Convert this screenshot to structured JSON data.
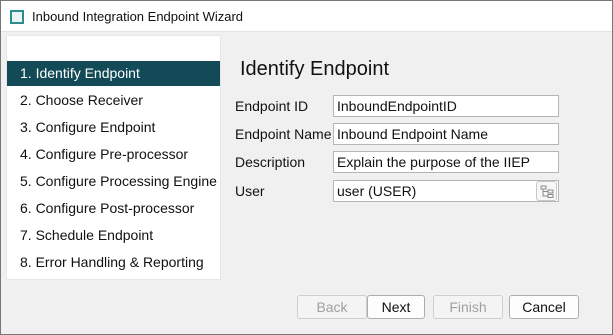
{
  "window": {
    "title": "Inbound Integration Endpoint Wizard"
  },
  "steps": [
    {
      "label": "1. Identify Endpoint",
      "active": true
    },
    {
      "label": "2. Choose Receiver",
      "active": false
    },
    {
      "label": "3. Configure Endpoint",
      "active": false
    },
    {
      "label": "4. Configure Pre-processor",
      "active": false
    },
    {
      "label": "5. Configure Processing Engine",
      "active": false
    },
    {
      "label": "6. Configure Post-processor",
      "active": false
    },
    {
      "label": "7. Schedule Endpoint",
      "active": false
    },
    {
      "label": "8. Error Handling & Reporting",
      "active": false
    }
  ],
  "page": {
    "heading": "Identify Endpoint"
  },
  "form": {
    "endpoint_id": {
      "label": "Endpoint ID",
      "value": "InboundEndpointID"
    },
    "endpoint_name": {
      "label": "Endpoint Name",
      "value": "Inbound Endpoint Name"
    },
    "description": {
      "label": "Description",
      "value": "Explain the purpose of the IIEP"
    },
    "user": {
      "label": "User",
      "value": "user (USER)",
      "lookup_icon": "tree-browse-icon"
    }
  },
  "buttons": {
    "back": "Back",
    "next": "Next",
    "finish": "Finish",
    "cancel": "Cancel"
  }
}
